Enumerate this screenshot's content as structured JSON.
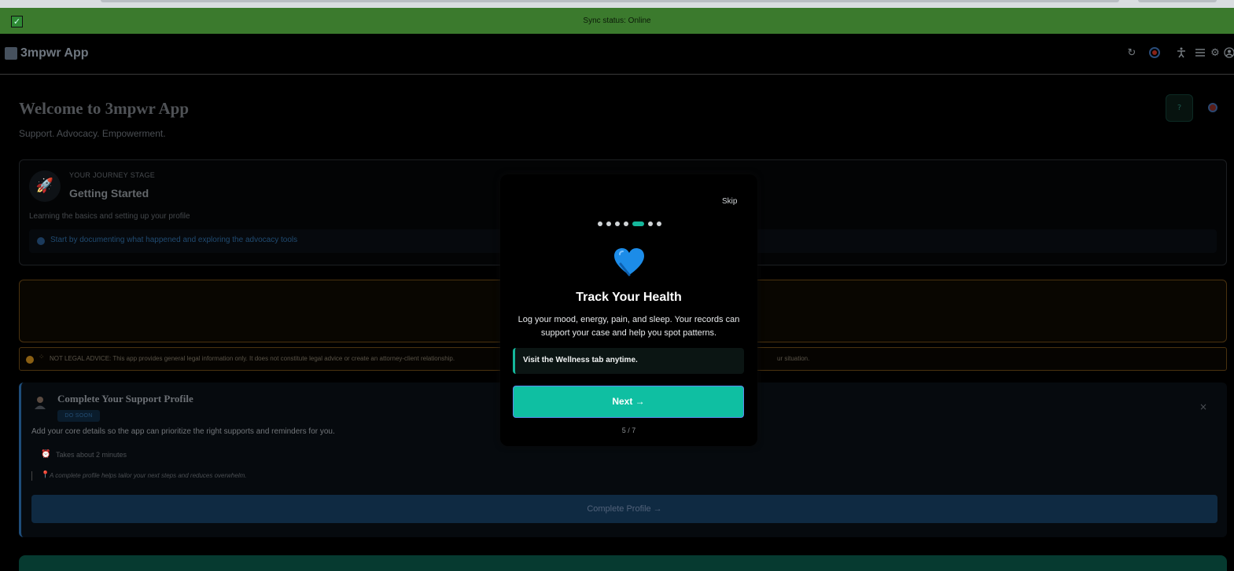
{
  "sync": {
    "status": "Sync status: Online"
  },
  "header": {
    "app_name": "3mpwr App",
    "icons": [
      "refresh-icon",
      "target-icon",
      "accessibility-icon",
      "menu-icon",
      "gear-icon",
      "user-icon"
    ]
  },
  "welcome": {
    "title": "Welcome to 3mpwr App",
    "subtitle": "Support. Advocacy. Empowerment.",
    "help_label": "?"
  },
  "journey": {
    "label": "YOUR JOURNEY STAGE",
    "stage": "Getting Started",
    "description": "Learning the basics and setting up your profile",
    "tip": "Start by documenting what happened and exploring the advocacy tools"
  },
  "legal": {
    "text_start": "NOT LEGAL ADVICE: This app provides general legal information only. It does not constitute legal advice or create an attorney-client relationship.",
    "text_end": "ur situation."
  },
  "profile_card": {
    "title": "Complete Your Support Profile",
    "badge": "DO SOON",
    "description": "Add your core details so the app can prioritize the right supports and reminders for you.",
    "time": "Takes about 2 minutes",
    "hint": "A complete profile helps tailor your next steps and reduces overwhelm.",
    "cta": "Complete Profile →",
    "close": "×"
  },
  "modal": {
    "skip": "Skip",
    "steps_total": 7,
    "step_current": 5,
    "icon": "blue-heart-icon",
    "title": "Track Your Health",
    "description": "Log your mood, energy, pain, and sleep. Your records can support your case and help you spot patterns.",
    "callout": "Visit the Wellness tab anytime.",
    "next_label": "Next →",
    "counter": "5 / 7"
  },
  "colors": {
    "sync_green": "#3b7a2d",
    "accent_teal": "#0fbfa2",
    "heart_blue": "#1c8ce8"
  }
}
